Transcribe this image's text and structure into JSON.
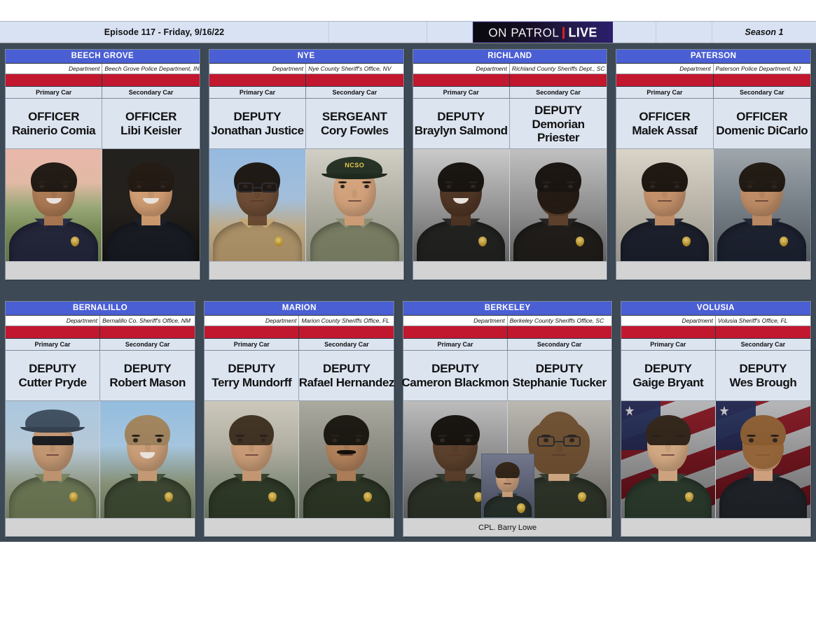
{
  "header": {
    "episode": "Episode 117 - Friday, 9/16/22",
    "logo": {
      "part1": "ON PATROL",
      "part2": "LIVE",
      "divider_color": "#d62027",
      "bg_color": "#140d20"
    },
    "season": "Season 1"
  },
  "labels": {
    "department": "Department",
    "primary_car": "Primary Car",
    "secondary_car": "Secondary Car"
  },
  "colors": {
    "board_bg": "#3d4a56",
    "card_title_bg": "#4a5fd4",
    "accent_red": "#c2182f",
    "card_bg": "#dce4f0",
    "footer_gray": "#d3d3d3",
    "header_bar": "#d9e2f3"
  },
  "cards": [
    {
      "title": "BEECH GROVE",
      "department": "Beech Grove Police Department, IN",
      "primary": {
        "rank": "OFFICER",
        "name": "Rainerio Comia",
        "wrap": false
      },
      "secondary": {
        "rank": "OFFICER",
        "name": "Libi Keisler",
        "wrap": false
      },
      "footer_caption": "",
      "inset": null
    },
    {
      "title": "NYE",
      "department": "Nye County Sheriff's Office, NV",
      "primary": {
        "rank": "DEPUTY",
        "name": "Jonathan Justice",
        "wrap": false
      },
      "secondary": {
        "rank": "SERGEANT",
        "name": "Cory Fowles",
        "wrap": false
      },
      "footer_caption": "",
      "inset": null
    },
    {
      "title": "RICHLAND",
      "department": "Richland County Sheriffs Dept., SC",
      "primary": {
        "rank": "DEPUTY",
        "name": "Braylyn Salmond",
        "wrap": false
      },
      "secondary": {
        "rank": "DEPUTY",
        "name": "Demorian Priester",
        "wrap": true
      },
      "footer_caption": "",
      "inset": null
    },
    {
      "title": "PATERSON",
      "department": "Paterson Police Department, NJ",
      "primary": {
        "rank": "OFFICER",
        "name": "Malek Assaf",
        "wrap": false
      },
      "secondary": {
        "rank": "OFFICER",
        "name": "Domenic DiCarlo",
        "wrap": false
      },
      "footer_caption": "",
      "inset": null
    },
    {
      "title": "BERNALILLO",
      "department": "Bernalillo Co. Sheriff's Office, NM",
      "primary": {
        "rank": "DEPUTY",
        "name": "Cutter Pryde",
        "wrap": false
      },
      "secondary": {
        "rank": "DEPUTY",
        "name": "Robert Mason",
        "wrap": false
      },
      "footer_caption": "",
      "inset": null
    },
    {
      "title": "MARION",
      "department": "Marion County Sheriffs Office, FL",
      "primary": {
        "rank": "DEPUTY",
        "name": "Terry Mundorff",
        "wrap": false
      },
      "secondary": {
        "rank": "DEPUTY",
        "name": "Rafael Hernandez",
        "wrap": false
      },
      "footer_caption": "",
      "inset": null
    },
    {
      "title": "BERKELEY",
      "department": "Berkeley County Sheriffs Office, SC",
      "primary": {
        "rank": "DEPUTY",
        "name": "Cameron Blackmon",
        "wrap": false
      },
      "secondary": {
        "rank": "DEPUTY",
        "name": "Stephanie Tucker",
        "wrap": false
      },
      "footer_caption": "CPL. Barry Lowe",
      "inset": "CPL. Barry Lowe"
    },
    {
      "title": "VOLUSIA",
      "department": "Volusia Sheriff's Office, FL",
      "primary": {
        "rank": "DEPUTY",
        "name": "Gaige Bryant",
        "wrap": false
      },
      "secondary": {
        "rank": "DEPUTY",
        "name": "Wes Brough",
        "wrap": false
      },
      "footer_caption": "",
      "inset": null
    }
  ]
}
